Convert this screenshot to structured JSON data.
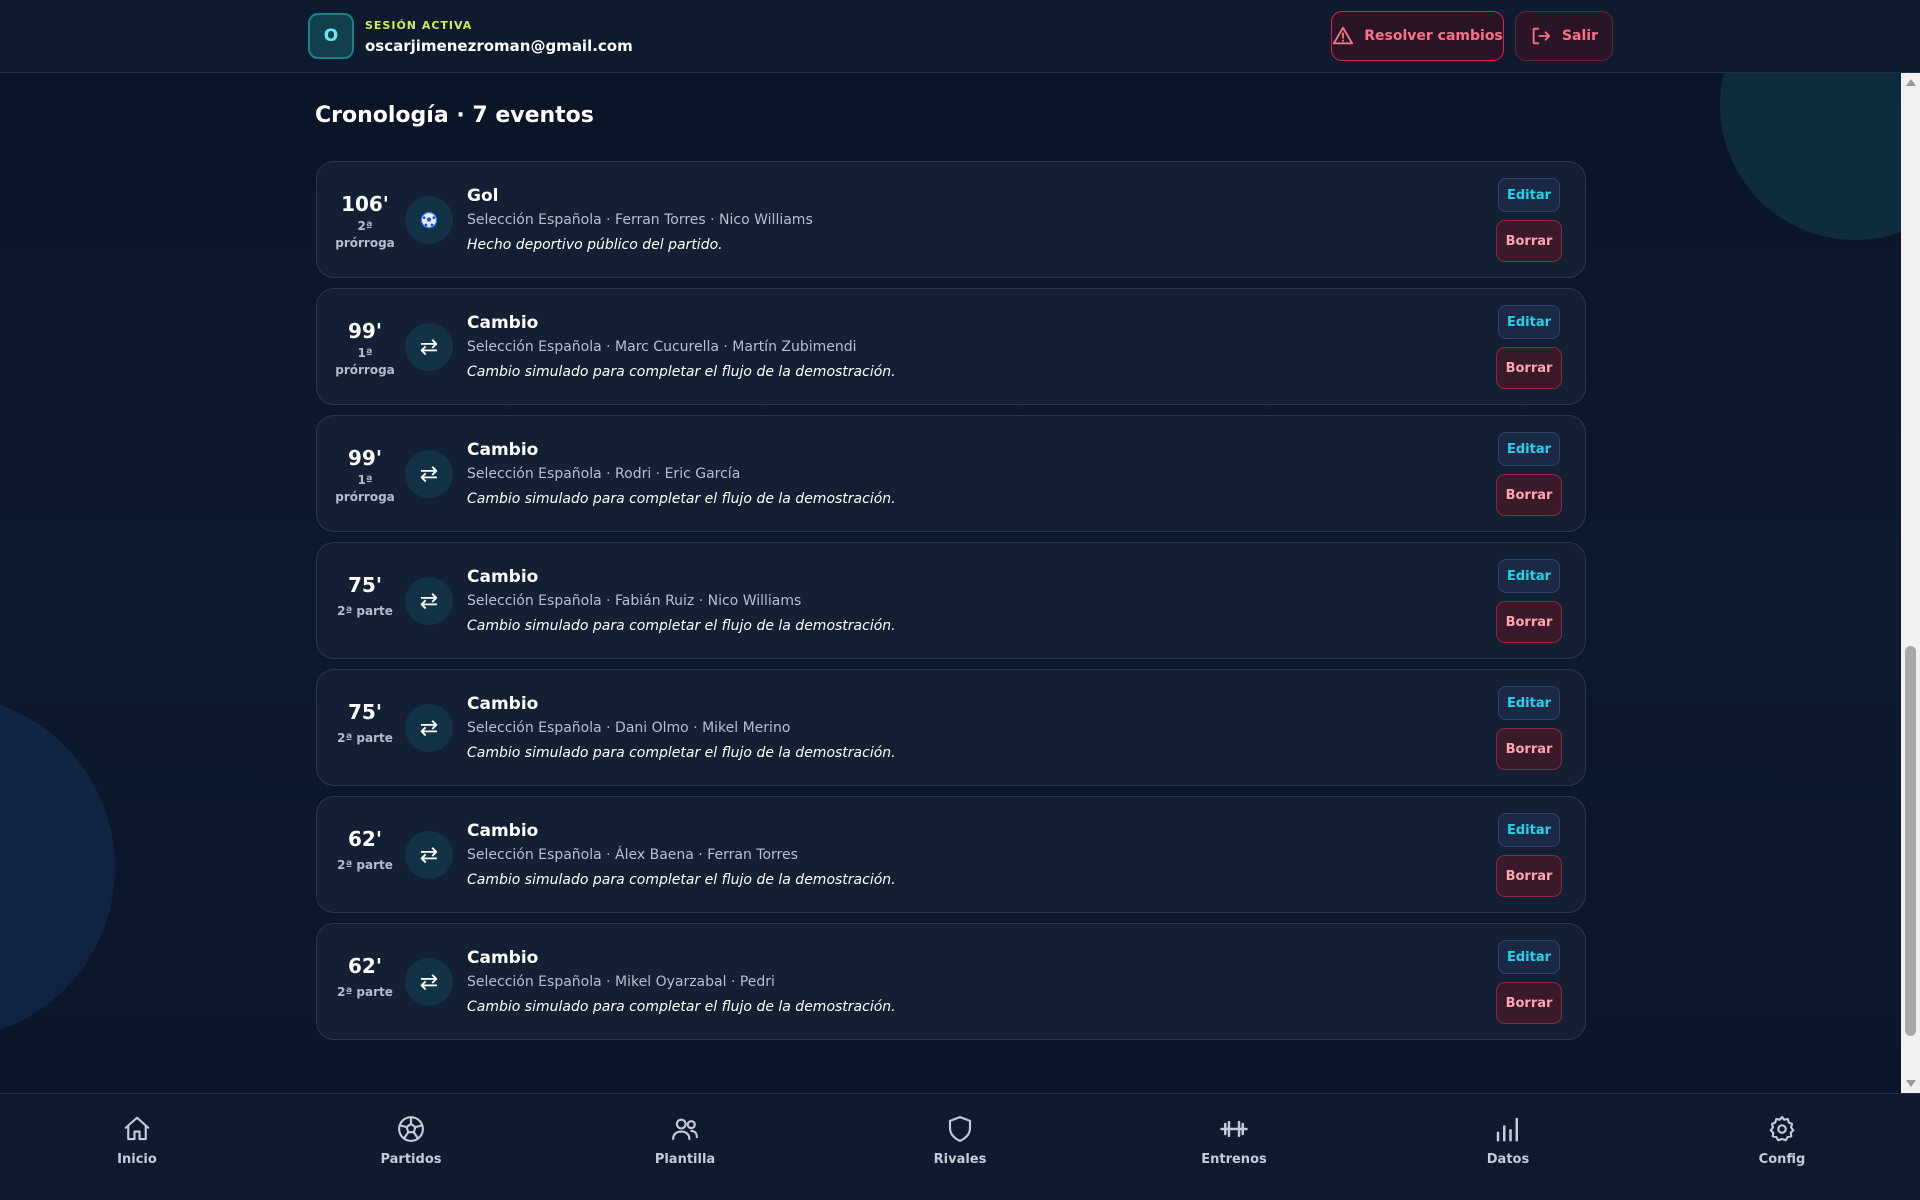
{
  "header": {
    "avatar_initial": "O",
    "session_label": "SESIÓN ACTIVA",
    "email": "oscarjimenezroman@gmail.com",
    "resolve_label": "Resolver cambios",
    "resolve_icon": "warning-triangle-icon",
    "exit_label": "Salir",
    "exit_icon": "logout-icon"
  },
  "section": {
    "title": "Cronología · 7 eventos"
  },
  "events": [
    {
      "minute": "106'",
      "period_line1": "2ª",
      "period_line2": "prórroga",
      "type": "Gol",
      "icon": "soccer-ball-icon",
      "meta": "Selección Española · Ferran Torres · Nico Williams",
      "note": "Hecho deportivo público del partido.",
      "edit_label": "Editar",
      "delete_label": "Borrar"
    },
    {
      "minute": "99'",
      "period_line1": "1ª",
      "period_line2": "prórroga",
      "type": "Cambio",
      "icon": "swap-arrows-icon",
      "meta": "Selección Española · Marc Cucurella · Martín Zubimendi",
      "note": "Cambio simulado para completar el flujo de la demostración.",
      "edit_label": "Editar",
      "delete_label": "Borrar"
    },
    {
      "minute": "99'",
      "period_line1": "1ª",
      "period_line2": "prórroga",
      "type": "Cambio",
      "icon": "swap-arrows-icon",
      "meta": "Selección Española · Rodri · Eric García",
      "note": "Cambio simulado para completar el flujo de la demostración.",
      "edit_label": "Editar",
      "delete_label": "Borrar"
    },
    {
      "minute": "75'",
      "period_line1": "2ª parte",
      "period_line2": "",
      "type": "Cambio",
      "icon": "swap-arrows-icon",
      "meta": "Selección Española · Fabián Ruiz · Nico Williams",
      "note": "Cambio simulado para completar el flujo de la demostración.",
      "edit_label": "Editar",
      "delete_label": "Borrar"
    },
    {
      "minute": "75'",
      "period_line1": "2ª parte",
      "period_line2": "",
      "type": "Cambio",
      "icon": "swap-arrows-icon",
      "meta": "Selección Española · Dani Olmo · Mikel Merino",
      "note": "Cambio simulado para completar el flujo de la demostración.",
      "edit_label": "Editar",
      "delete_label": "Borrar"
    },
    {
      "minute": "62'",
      "period_line1": "2ª parte",
      "period_line2": "",
      "type": "Cambio",
      "icon": "swap-arrows-icon",
      "meta": "Selección Española · Álex Baena · Ferran Torres",
      "note": "Cambio simulado para completar el flujo de la demostración.",
      "edit_label": "Editar",
      "delete_label": "Borrar"
    },
    {
      "minute": "62'",
      "period_line1": "2ª parte",
      "period_line2": "",
      "type": "Cambio",
      "icon": "swap-arrows-icon",
      "meta": "Selección Española · Mikel Oyarzabal · Pedri",
      "note": "Cambio simulado para completar el flujo de la demostración.",
      "edit_label": "Editar",
      "delete_label": "Borrar"
    }
  ],
  "nav": [
    {
      "label": "Inicio",
      "icon": "home-icon"
    },
    {
      "label": "Partidos",
      "icon": "soccer-ball-icon"
    },
    {
      "label": "Plantilla",
      "icon": "users-icon"
    },
    {
      "label": "Rivales",
      "icon": "shield-icon"
    },
    {
      "label": "Entrenos",
      "icon": "dumbbell-icon"
    },
    {
      "label": "Datos",
      "icon": "bar-chart-icon"
    },
    {
      "label": "Config",
      "icon": "gear-icon"
    }
  ],
  "colors": {
    "background": "#0b1628",
    "accent_cyan": "#22d3ee",
    "accent_lime": "#c6f24e",
    "danger": "#fb7185"
  }
}
